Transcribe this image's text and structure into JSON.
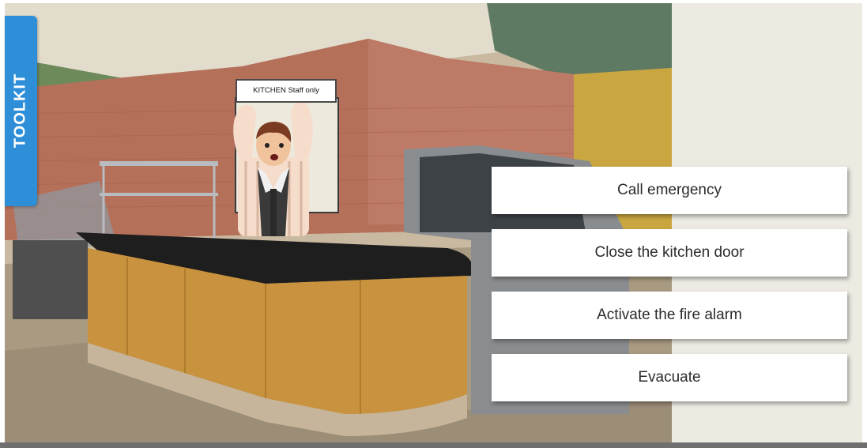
{
  "toolkit": {
    "label": "TOOLKIT"
  },
  "scene": {
    "sign_text": "KITCHEN Staff only",
    "character": "panicked-man-arms-raised"
  },
  "options": [
    {
      "label": "Call emergency"
    },
    {
      "label": "Close the kitchen door"
    },
    {
      "label": "Activate the fire alarm"
    },
    {
      "label": "Evacuate"
    }
  ],
  "colors": {
    "toolkit_tab": "#2e8fd8",
    "side_panel": "#eceae1",
    "option_bg": "#ffffff",
    "bottom_bar": "#6f6f6f"
  }
}
